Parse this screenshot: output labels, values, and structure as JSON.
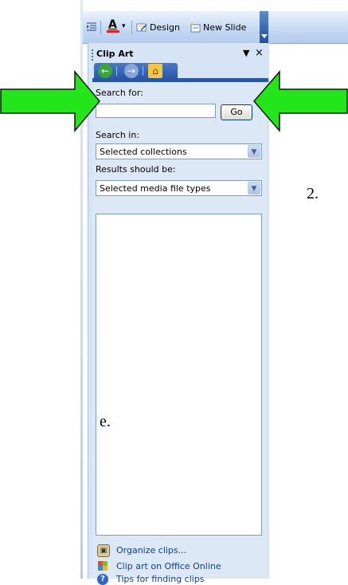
{
  "toolbar": {
    "font_color_label": "A",
    "font_color_dropdown": "▾",
    "design_label": "Design",
    "new_slide_label": "New Slide"
  },
  "pane": {
    "title": "Clip Art",
    "menu_glyph": "▼",
    "close_glyph": "×",
    "nav": {
      "back": "←",
      "forward": "→",
      "home": "⌂"
    }
  },
  "search": {
    "label": "Search for:",
    "value": "",
    "go_label": "Go"
  },
  "search_in": {
    "label": "Search in:",
    "selected": "Selected collections"
  },
  "results_type": {
    "label": "Results should be:",
    "selected": "Selected media file types"
  },
  "links": [
    {
      "label": "Organize clips...",
      "icon": "organize-clips-icon"
    },
    {
      "label": "Clip art on Office Online",
      "icon": "office-online-icon"
    },
    {
      "label": "Tips for finding clips",
      "icon": "help-icon"
    }
  ],
  "annotations": {
    "step_number": "2.",
    "letter": "e."
  },
  "colors": {
    "arrow_fill": "#22e61a",
    "arrow_stroke": "#0a1a0a",
    "pane_bg": "#d7e4f6",
    "nav_bar": "#2a56a8",
    "link_text": "#0b3f9e"
  }
}
